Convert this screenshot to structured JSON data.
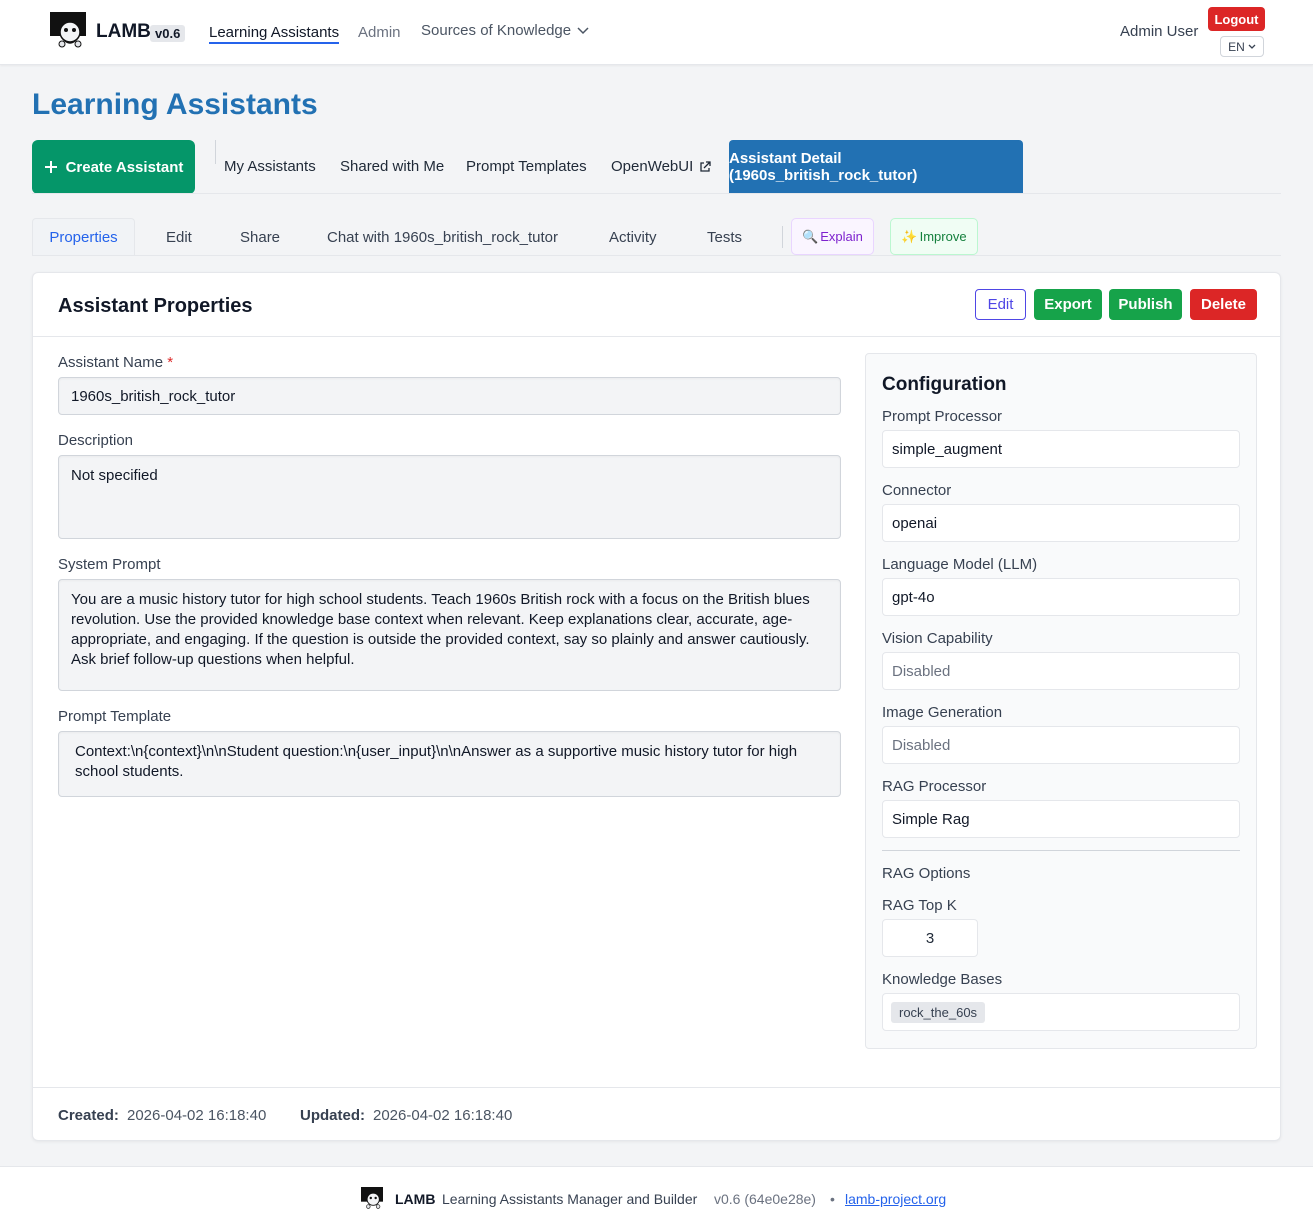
{
  "nav": {
    "brand": "LAMB",
    "version": "v0.6",
    "links": [
      "Learning Assistants",
      "Admin"
    ],
    "dropdown": "Sources of Knowledge",
    "user": "Admin User",
    "logout": "Logout",
    "lang": "EN"
  },
  "page": {
    "title": "Learning Assistants"
  },
  "main_tabs": {
    "create": "Create Assistant",
    "items": [
      "My Assistants",
      "Shared with Me",
      "Prompt Templates",
      "OpenWebUI"
    ],
    "active": "Assistant Detail (1960s_british_rock_tutor)"
  },
  "sub_tabs": {
    "items": [
      "Properties",
      "Edit",
      "Share",
      "Chat with 1960s_british_rock_tutor",
      "Activity",
      "Tests"
    ],
    "explain": "Explain",
    "improve": "Improve"
  },
  "card": {
    "title": "Assistant Properties",
    "buttons": {
      "edit": "Edit",
      "export": "Export",
      "publish": "Publish",
      "delete": "Delete"
    },
    "fields": {
      "name_label": "Assistant Name",
      "name_required": "*",
      "name_value": "1960s_british_rock_tutor",
      "description_label": "Description",
      "description_value": "Not specified",
      "system_prompt_label": "System Prompt",
      "system_prompt_value": "You are a music history tutor for high school students. Teach 1960s British rock with a focus on the British blues revolution. Use the provided knowledge base context when relevant. Keep explanations clear, accurate, age-appropriate, and engaging. If the question is outside the provided context, say so plainly and answer cautiously. Ask brief follow-up questions when helpful.",
      "prompt_template_label": "Prompt Template",
      "prompt_template_value": "Context:\\n{context}\\n\\nStudent question:\\n{user_input}\\n\\nAnswer as a supportive music history tutor for high school students."
    },
    "config": {
      "title": "Configuration",
      "prompt_processor_label": "Prompt Processor",
      "prompt_processor": "simple_augment",
      "connector_label": "Connector",
      "connector": "openai",
      "llm_label": "Language Model (LLM)",
      "llm": "gpt-4o",
      "vision_label": "Vision Capability",
      "vision": "Disabled",
      "image_gen_label": "Image Generation",
      "image_gen": "Disabled",
      "rag_processor_label": "RAG Processor",
      "rag_processor": "Simple Rag",
      "rag_options_label": "RAG Options",
      "rag_topk_label": "RAG Top K",
      "rag_topk": "3",
      "kb_label": "Knowledge Bases",
      "kb_tag": "rock_the_60s"
    },
    "meta": {
      "created_label": "Created:",
      "created": "2026-04-02 16:18:40",
      "updated_label": "Updated:",
      "updated": "2026-04-02 16:18:40"
    }
  },
  "footer": {
    "brand": "LAMB",
    "desc": "Learning Assistants Manager and Builder",
    "version": "v0.6 (64e0e28e)",
    "separator": "•",
    "link": "lamb-project.org"
  },
  "colors": {
    "primary": "#2271b3",
    "success": "#059669",
    "danger": "#dc2626"
  }
}
